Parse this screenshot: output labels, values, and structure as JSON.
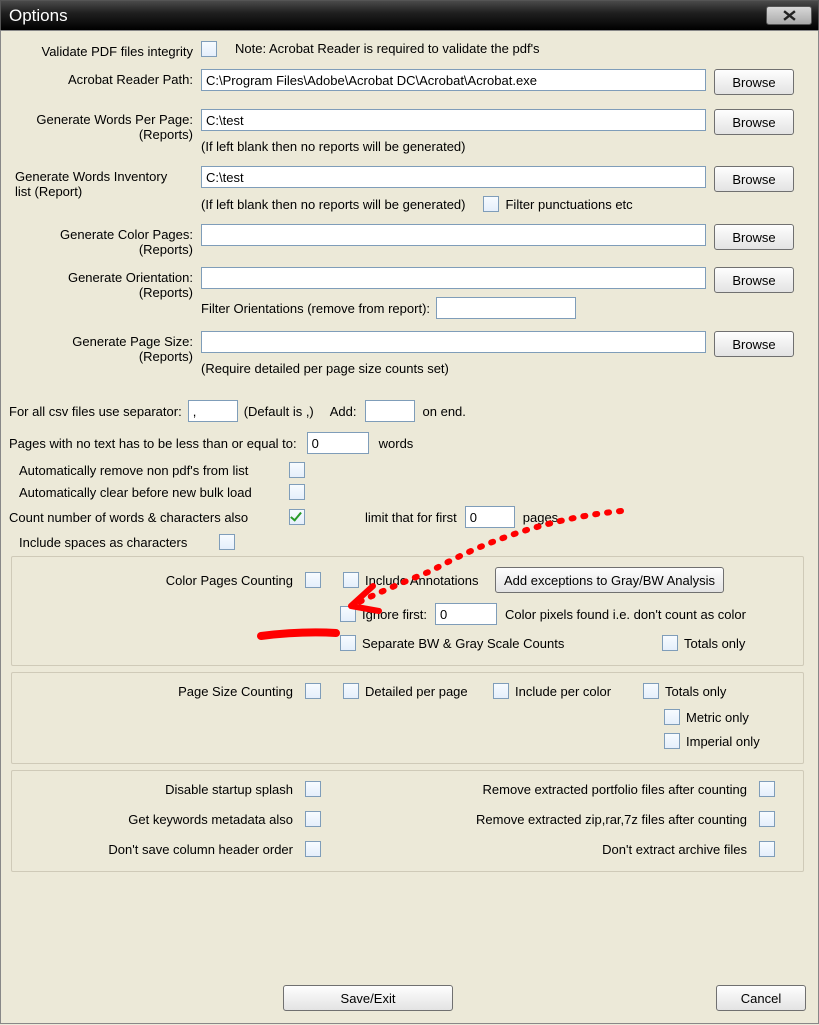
{
  "window": {
    "title": "Options"
  },
  "validate": {
    "label": "Validate PDF files integrity",
    "checked": false,
    "note": "Note: Acrobat Reader is required to validate the pdf's"
  },
  "acrobat": {
    "label": "Acrobat Reader Path:",
    "value": "C:\\Program Files\\Adobe\\Acrobat DC\\Acrobat\\Acrobat.exe",
    "browse": "Browse"
  },
  "wordsPerPage": {
    "label1": "Generate Words Per Page:",
    "label2": "(Reports)",
    "value": "C:\\test",
    "hint": "(If left blank then no reports will be generated)",
    "browse": "Browse"
  },
  "wordsInventory": {
    "label1": "Generate Words Inventory",
    "label2": "list (Report)",
    "value": "C:\\test",
    "hint": "(If left blank then no reports will be generated)",
    "filterLabel": "Filter punctuations etc",
    "filterChecked": false,
    "browse": "Browse"
  },
  "colorPages": {
    "label1": "Generate Color Pages:",
    "label2": "(Reports)",
    "value": "",
    "browse": "Browse"
  },
  "orientation": {
    "label1": "Generate Orientation:",
    "label2": "(Reports)",
    "value": "",
    "filterLabel": "Filter Orientations (remove from report):",
    "filterValue": "",
    "browse": "Browse"
  },
  "pageSize": {
    "label1": "Generate Page Size:",
    "label2": "(Reports)",
    "value": "",
    "hint": "(Require detailed per page size counts set)",
    "browse": "Browse"
  },
  "csvSep": {
    "prefix": "For all csv files use separator:",
    "value": ",",
    "default": "(Default is ,)",
    "addLabel": "Add:",
    "addValue": "",
    "suffix": "on end."
  },
  "noText": {
    "prefix": "Pages with no text has to be less than or equal to:",
    "value": "0",
    "suffix": "words"
  },
  "autoRemove": {
    "label": "Automatically remove non pdf's from list",
    "checked": false
  },
  "autoClear": {
    "label": "Automatically clear before new bulk load",
    "checked": false
  },
  "countWords": {
    "label": "Count number of words & characters also",
    "checked": true,
    "limitPrefix": "limit that for first",
    "limitValue": "0",
    "limitSuffix": "pages"
  },
  "includeSpaces": {
    "label": "Include spaces as characters",
    "checked": false
  },
  "colorCount": {
    "label": "Color Pages Counting",
    "mainChecked": false,
    "includeAnnot": {
      "label": "Include Annotations",
      "checked": false
    },
    "addExceptions": "Add exceptions to Gray/BW Analysis",
    "ignoreFirst": {
      "label": "Ignore first:",
      "checked": false,
      "value": "0",
      "suffix": "Color pixels found i.e. don't count as color"
    },
    "sepBW": {
      "label": "Separate BW & Gray Scale Counts",
      "checked": false
    },
    "totalsOnly": {
      "label": "Totals only",
      "checked": false
    }
  },
  "sizeCount": {
    "label": "Page Size Counting",
    "mainChecked": false,
    "detailed": {
      "label": "Detailed per page",
      "checked": false
    },
    "perColor": {
      "label": "Include per color",
      "checked": false
    },
    "totals": {
      "label": "Totals only",
      "checked": false
    },
    "metric": {
      "label": "Metric only",
      "checked": false
    },
    "imperial": {
      "label": "Imperial only",
      "checked": false
    }
  },
  "misc": {
    "disableSplash": {
      "label": "Disable startup splash",
      "checked": false
    },
    "removePortfolio": {
      "label": "Remove extracted portfolio files after counting",
      "checked": false
    },
    "getKeywords": {
      "label": "Get keywords metadata also",
      "checked": false
    },
    "removeZip": {
      "label": "Remove extracted zip,rar,7z files after counting",
      "checked": false
    },
    "dontSaveHeader": {
      "label": "Don't save column header order",
      "checked": false
    },
    "dontExtract": {
      "label": "Don't extract archive files",
      "checked": false
    }
  },
  "buttons": {
    "save": "Save/Exit",
    "cancel": "Cancel"
  }
}
